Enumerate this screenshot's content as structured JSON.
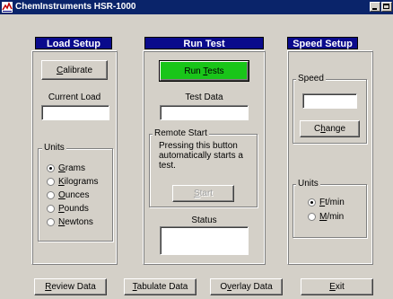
{
  "window": {
    "title": "ChemInstruments HSR-1000",
    "icon": "app-icon",
    "controls": [
      "minimize-icon",
      "maximize-icon"
    ]
  },
  "load_setup": {
    "header": "Load Setup",
    "calibrate_label": "Calibrate",
    "calibrate_mnemonic": "C",
    "calibrate_rest": "alibrate",
    "current_load_label": "Current Load",
    "current_load_value": "",
    "units_label": "Units",
    "units": [
      {
        "mnemonic": "G",
        "rest": "rams",
        "label": "Grams",
        "checked": true
      },
      {
        "mnemonic": "K",
        "rest": "ilograms",
        "label": "Kilograms",
        "checked": false
      },
      {
        "mnemonic": "O",
        "rest": "unces",
        "label": "Ounces",
        "checked": false
      },
      {
        "mnemonic": "P",
        "rest": "ounds",
        "label": "Pounds",
        "checked": false
      },
      {
        "mnemonic": "N",
        "rest": "ewtons",
        "label": "Newtons",
        "checked": false
      }
    ]
  },
  "run_test": {
    "header": "Run Test",
    "run_pre": "Run ",
    "run_mnemonic": "T",
    "run_rest": "ests",
    "run_label": "Run Tests",
    "run_color": "#19c519",
    "test_data_label": "Test Data",
    "test_data_value": "",
    "remote_start_label": "Remote Start",
    "remote_text_1": "Pressing this button",
    "remote_text_2": "automatically starts a",
    "remote_text_3": "test.",
    "start_mnemonic": "S",
    "start_rest": "tart",
    "start_label": "Start",
    "status_label": "Status",
    "status_value": ""
  },
  "speed_setup": {
    "header": "Speed Setup",
    "speed_label": "Speed",
    "speed_value": "",
    "change_mnemonic": "h",
    "change_pre": "C",
    "change_rest": "ange",
    "change_label": "Change",
    "units_label": "Units",
    "units": [
      {
        "mnemonic": "F",
        "rest": "t/min",
        "label": "Ft/min",
        "checked": true
      },
      {
        "mnemonic": "M",
        "rest": "/min",
        "label": "M/min",
        "checked": false
      }
    ]
  },
  "bottom_buttons": {
    "review_mnemonic": "R",
    "review_rest": "eview Data",
    "review_label": "Review Data",
    "tabulate_mnemonic": "T",
    "tabulate_rest": "abulate Data",
    "tabulate_label": "Tabulate Data",
    "overlay_pre": "O",
    "overlay_mnemonic": "v",
    "overlay_rest": "erlay Data",
    "overlay_label": "Overlay Data",
    "exit_mnemonic": "E",
    "exit_rest": "xit",
    "exit_label": "Exit"
  },
  "colors": {
    "title_bar": "#0a246a",
    "section_header": "#0a0a8c",
    "face": "#d4d0c8"
  }
}
